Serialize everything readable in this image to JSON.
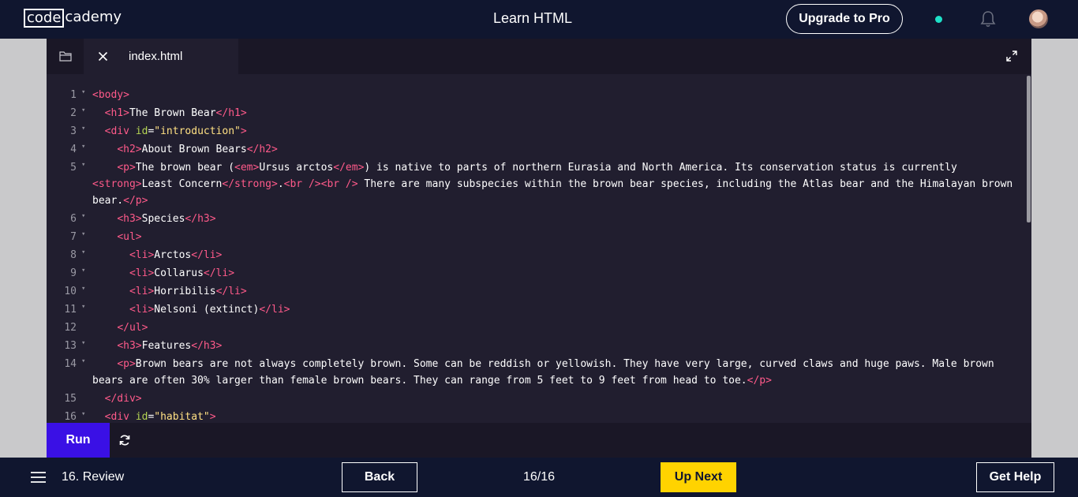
{
  "header": {
    "logo_boxed": "code",
    "logo_rest": "cademy",
    "title": "Learn HTML",
    "upgrade_label": "Upgrade to Pro",
    "status_dot_color": "#1ee0c8",
    "notification_icon": "bell-icon"
  },
  "editor": {
    "file_tab": "index.html",
    "folder_icon": "folder-icon",
    "close_icon": "close-icon",
    "expand_icon": "expand-icon",
    "lines": [
      {
        "num": "1",
        "fold": true,
        "tokens": [
          [
            "t",
            "<body>"
          ]
        ]
      },
      {
        "num": "2",
        "fold": true,
        "tokens": [
          [
            "x",
            "  "
          ],
          [
            "t",
            "<h1>"
          ],
          [
            "x",
            "The Brown Bear"
          ],
          [
            "t",
            "</h1>"
          ]
        ]
      },
      {
        "num": "3",
        "fold": true,
        "tokens": [
          [
            "x",
            "  "
          ],
          [
            "t",
            "<div"
          ],
          [
            "x",
            " "
          ],
          [
            "a",
            "id"
          ],
          [
            "x",
            "="
          ],
          [
            "s",
            "\"introduction\""
          ],
          [
            "t",
            ">"
          ]
        ]
      },
      {
        "num": "4",
        "fold": true,
        "tokens": [
          [
            "x",
            "    "
          ],
          [
            "t",
            "<h2>"
          ],
          [
            "x",
            "About Brown Bears"
          ],
          [
            "t",
            "</h2>"
          ]
        ]
      },
      {
        "num": "5",
        "fold": true,
        "tokens": [
          [
            "x",
            "    "
          ],
          [
            "t",
            "<p>"
          ],
          [
            "x",
            "The brown bear ("
          ],
          [
            "t",
            "<em>"
          ],
          [
            "x",
            "Ursus arctos"
          ],
          [
            "t",
            "</em>"
          ],
          [
            "x",
            ") is native to parts of northern Eurasia and North America. Its conservation status is currently "
          ],
          [
            "t",
            "<strong>"
          ],
          [
            "x",
            "Least Concern"
          ],
          [
            "t",
            "</strong>"
          ],
          [
            "x",
            "."
          ],
          [
            "t",
            "<br />"
          ],
          [
            "t",
            "<br />"
          ],
          [
            "x",
            " There are many subspecies within the brown bear species, including the Atlas bear and the Himalayan brown bear."
          ],
          [
            "t",
            "</p>"
          ]
        ]
      },
      {
        "num": "6",
        "fold": true,
        "tokens": [
          [
            "x",
            "    "
          ],
          [
            "t",
            "<h3>"
          ],
          [
            "x",
            "Species"
          ],
          [
            "t",
            "</h3>"
          ]
        ]
      },
      {
        "num": "7",
        "fold": true,
        "tokens": [
          [
            "x",
            "    "
          ],
          [
            "t",
            "<ul>"
          ]
        ]
      },
      {
        "num": "8",
        "fold": true,
        "tokens": [
          [
            "x",
            "      "
          ],
          [
            "t",
            "<li>"
          ],
          [
            "x",
            "Arctos"
          ],
          [
            "t",
            "</li>"
          ]
        ]
      },
      {
        "num": "9",
        "fold": true,
        "tokens": [
          [
            "x",
            "      "
          ],
          [
            "t",
            "<li>"
          ],
          [
            "x",
            "Collarus"
          ],
          [
            "t",
            "</li>"
          ]
        ]
      },
      {
        "num": "10",
        "fold": true,
        "tokens": [
          [
            "x",
            "      "
          ],
          [
            "t",
            "<li>"
          ],
          [
            "x",
            "Horribilis"
          ],
          [
            "t",
            "</li>"
          ]
        ]
      },
      {
        "num": "11",
        "fold": true,
        "tokens": [
          [
            "x",
            "      "
          ],
          [
            "t",
            "<li>"
          ],
          [
            "x",
            "Nelsoni (extinct)"
          ],
          [
            "t",
            "</li>"
          ]
        ]
      },
      {
        "num": "12",
        "fold": false,
        "tokens": [
          [
            "x",
            "    "
          ],
          [
            "t",
            "</ul>"
          ]
        ]
      },
      {
        "num": "13",
        "fold": true,
        "tokens": [
          [
            "x",
            "    "
          ],
          [
            "t",
            "<h3>"
          ],
          [
            "x",
            "Features"
          ],
          [
            "t",
            "</h3>"
          ]
        ]
      },
      {
        "num": "14",
        "fold": true,
        "tokens": [
          [
            "x",
            "    "
          ],
          [
            "t",
            "<p>"
          ],
          [
            "x",
            "Brown bears are not always completely brown. Some can be reddish or yellowish. They have very large, curved claws and huge paws. Male brown bears are often 30% larger than female brown bears. They can range from 5 feet to 9 feet from head to toe."
          ],
          [
            "t",
            "</p>"
          ]
        ]
      },
      {
        "num": "15",
        "fold": false,
        "tokens": [
          [
            "x",
            "  "
          ],
          [
            "t",
            "</div>"
          ]
        ]
      },
      {
        "num": "16",
        "fold": true,
        "tokens": [
          [
            "x",
            "  "
          ],
          [
            "t",
            "<div"
          ],
          [
            "x",
            " "
          ],
          [
            "a",
            "id"
          ],
          [
            "x",
            "="
          ],
          [
            "s",
            "\"habitat\""
          ],
          [
            "t",
            ">"
          ]
        ]
      }
    ]
  },
  "actions": {
    "run_label": "Run",
    "refresh_icon": "refresh-icon"
  },
  "footer": {
    "menu_icon": "menu-icon",
    "lesson_label": "16. Review",
    "back_label": "Back",
    "progress": "16/16",
    "next_label": "Up Next",
    "help_label": "Get Help"
  },
  "colors": {
    "header_bg": "#10162f",
    "editor_bg": "#211e2f",
    "tag": "#ff5a8a",
    "attr": "#b4d353",
    "string": "#ffe083",
    "run_bg": "#3a10e5",
    "next_bg": "#ffd300"
  }
}
